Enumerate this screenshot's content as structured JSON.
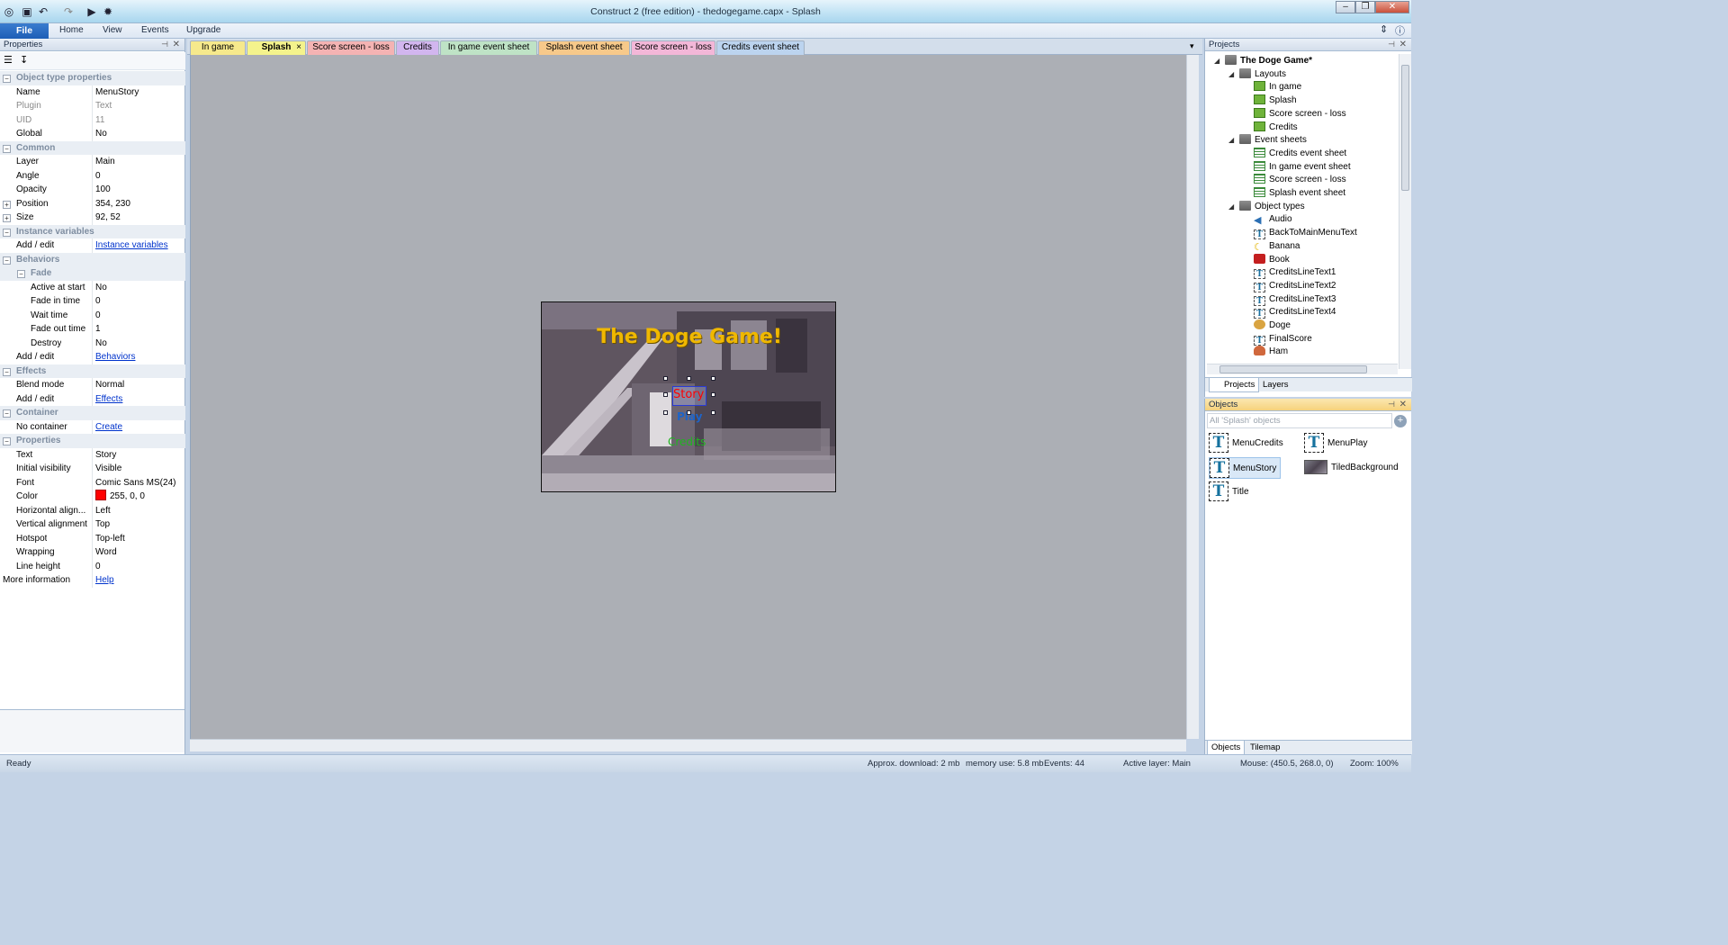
{
  "window": {
    "title": "Construct 2  (free edition) - thedogegame.capx - Splash"
  },
  "menu": {
    "file": "File",
    "items": [
      "Home",
      "View",
      "Events",
      "Upgrade"
    ]
  },
  "properties": {
    "header": "Properties",
    "rows": [
      {
        "type": "cat",
        "label": "Object type properties"
      },
      {
        "k": "Name",
        "v": "MenuStory"
      },
      {
        "k": "Plugin",
        "v": "Text",
        "grey": true
      },
      {
        "k": "UID",
        "v": "11",
        "grey": true
      },
      {
        "k": "Global",
        "v": "No"
      },
      {
        "type": "cat",
        "label": "Common"
      },
      {
        "k": "Layer",
        "v": "Main"
      },
      {
        "k": "Angle",
        "v": "0"
      },
      {
        "k": "Opacity",
        "v": "100"
      },
      {
        "k": "Position",
        "v": "354, 230",
        "expander": true
      },
      {
        "k": "Size",
        "v": "92, 52",
        "expander": true
      },
      {
        "type": "cat",
        "label": "Instance variables"
      },
      {
        "k": "Add / edit",
        "v": "Instance variables",
        "link": true
      },
      {
        "type": "cat",
        "label": "Behaviors"
      },
      {
        "type": "subcat",
        "label": "Fade"
      },
      {
        "k": "Active at start",
        "v": "No",
        "sub": true
      },
      {
        "k": "Fade in time",
        "v": "0",
        "sub": true
      },
      {
        "k": "Wait time",
        "v": "0",
        "sub": true
      },
      {
        "k": "Fade out time",
        "v": "1",
        "sub": true
      },
      {
        "k": "Destroy",
        "v": "No",
        "sub": true
      },
      {
        "k": "Add / edit",
        "v": "Behaviors",
        "link": true
      },
      {
        "type": "cat",
        "label": "Effects"
      },
      {
        "k": "Blend mode",
        "v": "Normal"
      },
      {
        "k": "Add / edit",
        "v": "Effects",
        "link": true
      },
      {
        "type": "cat",
        "label": "Container"
      },
      {
        "k": "No container",
        "v": "Create",
        "link": true
      },
      {
        "type": "cat",
        "label": "Properties"
      },
      {
        "k": "Text",
        "v": "Story"
      },
      {
        "k": "Initial visibility",
        "v": "Visible"
      },
      {
        "k": "Font",
        "v": "Comic Sans MS(24)"
      },
      {
        "k": "Color",
        "v": "255, 0, 0",
        "color": true
      },
      {
        "k": "Horizontal align...",
        "v": "Left"
      },
      {
        "k": "Vertical alignment",
        "v": "Top"
      },
      {
        "k": "Hotspot",
        "v": "Top-left"
      },
      {
        "k": "Wrapping",
        "v": "Word"
      },
      {
        "k": "Line height",
        "v": "0"
      },
      {
        "k": "More information",
        "v": "Help",
        "link": true,
        "root": true
      }
    ]
  },
  "tabs": [
    {
      "label": "In game",
      "color": "#f6e98c"
    },
    {
      "label": "Splash",
      "color": "#f4f38c",
      "active": true,
      "close": "×"
    },
    {
      "label": "Score screen - loss",
      "color": "#f4b3b3"
    },
    {
      "label": "Credits",
      "color": "#d2b6ef"
    },
    {
      "label": "In game event sheet",
      "color": "#bfe3c6"
    },
    {
      "label": "Splash event sheet",
      "color": "#f7c98a"
    },
    {
      "label": "Score screen - loss",
      "color": "#f3b7d8"
    },
    {
      "label": "Credits event sheet",
      "color": "#bcd4ef"
    }
  ],
  "canvas": {
    "title_text": "The Doge Game!",
    "story_text": "Story",
    "play_text": "Play",
    "credits_text": "Credits",
    "title_color": "#f0b800",
    "story_color": "#ff0000",
    "play_color": "#1e64c8",
    "credits_color": "#1fb51f"
  },
  "projects": {
    "header": "Projects",
    "root": "The Doge Game*",
    "layouts_label": "Layouts",
    "layouts": [
      "In game",
      "Splash",
      "Score screen - loss",
      "Credits"
    ],
    "eventsheets_label": "Event sheets",
    "eventsheets": [
      "Credits event sheet",
      "In game event sheet",
      "Score screen - loss",
      "Splash event sheet"
    ],
    "objecttypes_label": "Object types",
    "objecttypes": [
      {
        "name": "Audio",
        "icon": "audio"
      },
      {
        "name": "BackToMainMenuText",
        "icon": "text"
      },
      {
        "name": "Banana",
        "icon": "banana"
      },
      {
        "name": "Book",
        "icon": "book"
      },
      {
        "name": "CreditsLineText1",
        "icon": "text"
      },
      {
        "name": "CreditsLineText2",
        "icon": "text"
      },
      {
        "name": "CreditsLineText3",
        "icon": "text"
      },
      {
        "name": "CreditsLineText4",
        "icon": "text"
      },
      {
        "name": "Doge",
        "icon": "doge"
      },
      {
        "name": "FinalScore",
        "icon": "text"
      },
      {
        "name": "Ham",
        "icon": "ham"
      }
    ],
    "tab_projects": "Projects",
    "tab_layers": "Layers"
  },
  "objects": {
    "header": "Objects",
    "filter_placeholder": "All 'Splash' objects",
    "items": [
      {
        "name": "MenuCredits",
        "kind": "text"
      },
      {
        "name": "MenuPlay",
        "kind": "text"
      },
      {
        "name": "MenuStory",
        "kind": "text",
        "selected": true
      },
      {
        "name": "TiledBackground",
        "kind": "tiled"
      },
      {
        "name": "Title",
        "kind": "text"
      }
    ],
    "tab_objects": "Objects",
    "tab_tilemap": "Tilemap"
  },
  "status": {
    "ready": "Ready",
    "download": "Approx. download: 2 mb",
    "memory": "memory use: 5.8 mb",
    "events": "Events: 44",
    "layer": "Active layer: Main",
    "mouse": "Mouse: (450.5, 268.0, 0)",
    "zoom": "Zoom: 100%"
  }
}
